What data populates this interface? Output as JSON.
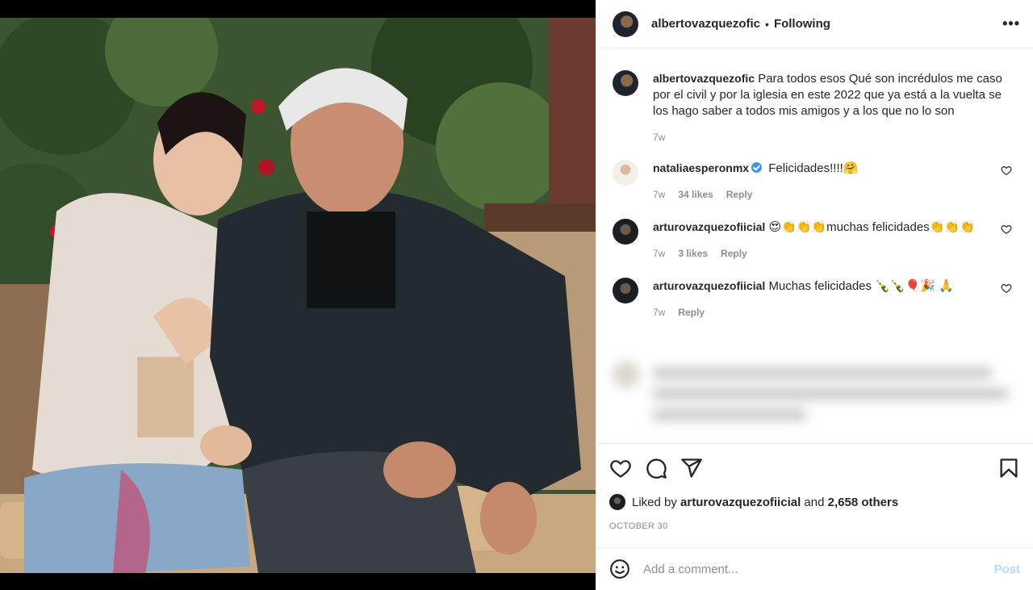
{
  "post": {
    "username": "albertovazquezofic",
    "follow_status": "Following",
    "dot": "•",
    "more": "•••",
    "caption": "Para todos esos Qué son incrédulos me caso por el civil y por la iglesia en este 2022 que ya está a la vuelta se los hago saber a todos mis amigos y a los que no lo son",
    "caption_time": "7w"
  },
  "comments": [
    {
      "username": "nataliaesperonmx",
      "verified": true,
      "text": "Felicidades!!!!🤗",
      "time": "7w",
      "likes": "34 likes",
      "reply": "Reply"
    },
    {
      "username": "arturovazquezofiicial",
      "text": "😍👏👏👏muchas felicidades👏👏👏",
      "time": "7w",
      "likes": "3 likes",
      "reply": "Reply"
    },
    {
      "username": "arturovazquezofiicial",
      "text": "Muchas felicidades 🍾🍾🎈🎉 🙏",
      "time": "7w",
      "reply": "Reply"
    }
  ],
  "likes": {
    "prefix": "Liked by",
    "user": "arturovazquezofiicial",
    "and": "and",
    "others": "2,658 others"
  },
  "date": "OCTOBER 30",
  "add_comment": {
    "placeholder": "Add a comment...",
    "post_label": "Post"
  },
  "icons": {
    "like": "heart-icon",
    "comment": "comment-icon",
    "share": "paper-plane-icon",
    "save": "bookmark-icon",
    "emoji": "emoji-smile-icon",
    "options": "more-options-icon"
  }
}
